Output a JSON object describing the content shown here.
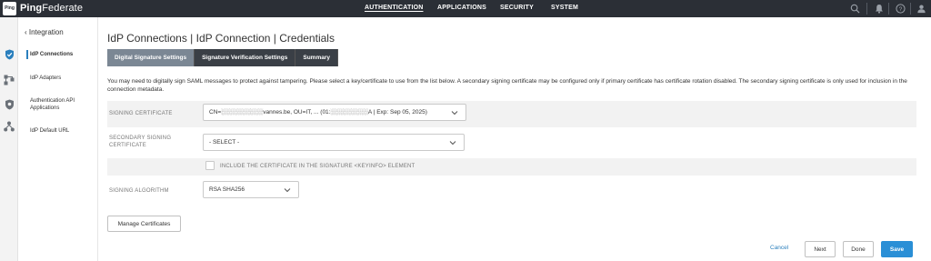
{
  "topbar": {
    "logo_text": "Ping",
    "brand_bold": "Ping",
    "brand_rest": "Federate",
    "nav": [
      "AUTHENTICATION",
      "APPLICATIONS",
      "SECURITY",
      "SYSTEM"
    ],
    "active_nav": "AUTHENTICATION"
  },
  "leftnav": {
    "back_label": "‹ Integration",
    "items": [
      "IdP Connections",
      "IdP Adapters",
      "Authentication API Applications",
      "IdP Default URL"
    ]
  },
  "main": {
    "title": "IdP Connections | IdP Connection | Credentials",
    "tabs": [
      "Digital Signature Settings",
      "Signature Verification Settings",
      "Summary"
    ],
    "description": "You may need to digitally sign SAML messages to protect against tampering. Please select a key/certificate to use from the list below. A secondary signing certificate may be configured only if primary certificate has certificate rotation disabled. The secondary signing certificate is only used for inclusion in the connection metadata.",
    "signing_certificate": {
      "label": "SIGNING CERTIFICATE",
      "value": "CN=░░░░░░░░░░vannes.be, OU=IT, ... (01:░░░░░░░░░A | Exp: Sep 05, 2025)"
    },
    "secondary_certificate": {
      "label": "SECONDARY SIGNING CERTIFICATE",
      "value": "- SELECT -"
    },
    "include_certificate_label": "INCLUDE THE CERTIFICATE IN THE SIGNATURE <KEYINFO> ELEMENT",
    "signing_algorithm": {
      "label": "SIGNING ALGORITHM",
      "value": "RSA SHA256"
    },
    "manage_certificates_label": "Manage Certificates"
  },
  "footer": {
    "cancel": "Cancel",
    "next": "Next",
    "done": "Done",
    "save": "Save"
  },
  "icons": {
    "search": "search-icon",
    "bell": "bell-icon",
    "help": "help-icon",
    "user": "user-icon",
    "rail": [
      "shield-check-icon",
      "network-icon",
      "shield-icon",
      "settings-network-icon"
    ]
  },
  "colors": {
    "topbar": "#2b2f36",
    "tab_active": "#7b8794",
    "tab_inactive": "#3a3f46",
    "primary": "#2a8fd6",
    "link": "#2a7fbd"
  }
}
